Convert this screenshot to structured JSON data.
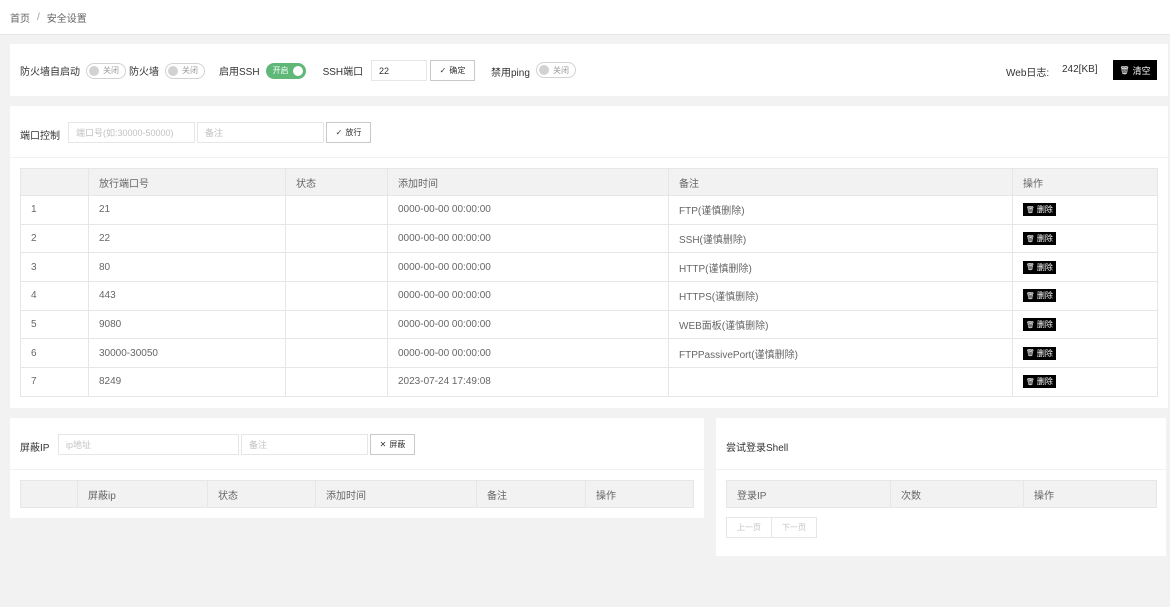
{
  "breadcrumb": {
    "home": "首页",
    "separator": "/",
    "current": "安全设置"
  },
  "settings": {
    "firewall_autostart_label": "防火墙自启动",
    "firewall_autostart_state": "关闭",
    "firewall_label": "防火墙",
    "firewall_state": "关闭",
    "ssh_enable_label": "启用SSH",
    "ssh_enable_state": "开启",
    "ssh_port_label": "SSH端口",
    "ssh_port_value": "22",
    "confirm_label": "确定",
    "ping_label": "禁用ping",
    "ping_state": "关闭",
    "weblog_label": "Web日志:",
    "weblog_size": "242[KB]",
    "clear_label": "清空"
  },
  "port_control": {
    "label": "端口控制",
    "port_placeholder": "端口号(如:30000-50000)",
    "note_placeholder": "备注",
    "allow_label": "放行",
    "columns": [
      "",
      "放行端口号",
      "状态",
      "添加时间",
      "备注",
      "操作"
    ],
    "rows": [
      {
        "id": "1",
        "port": "21",
        "status": "",
        "time": "0000-00-00 00:00:00",
        "note": "FTP(谨慎删除)"
      },
      {
        "id": "2",
        "port": "22",
        "status": "",
        "time": "0000-00-00 00:00:00",
        "note": "SSH(谨慎删除)"
      },
      {
        "id": "3",
        "port": "80",
        "status": "",
        "time": "0000-00-00 00:00:00",
        "note": "HTTP(谨慎删除)"
      },
      {
        "id": "4",
        "port": "443",
        "status": "",
        "time": "0000-00-00 00:00:00",
        "note": "HTTPS(谨慎删除)"
      },
      {
        "id": "5",
        "port": "9080",
        "status": "",
        "time": "0000-00-00 00:00:00",
        "note": "WEB面板(谨慎删除)"
      },
      {
        "id": "6",
        "port": "30000-30050",
        "status": "",
        "time": "0000-00-00 00:00:00",
        "note": "FTPPassivePort(谨慎删除)"
      },
      {
        "id": "7",
        "port": "8249",
        "status": "",
        "time": "2023-07-24 17:49:08",
        "note": ""
      }
    ],
    "delete_label": "删除"
  },
  "block_ip": {
    "label": "屏蔽IP",
    "ip_placeholder": "ip地址",
    "note_placeholder": "备注",
    "block_label": "屏蔽",
    "columns": [
      "",
      "屏蔽ip",
      "状态",
      "添加时间",
      "备注",
      "操作"
    ]
  },
  "shell_login": {
    "title": "尝试登录Shell",
    "columns": [
      "登录IP",
      "次数",
      "操作"
    ],
    "prev_label": "上一页",
    "next_label": "下一页"
  }
}
